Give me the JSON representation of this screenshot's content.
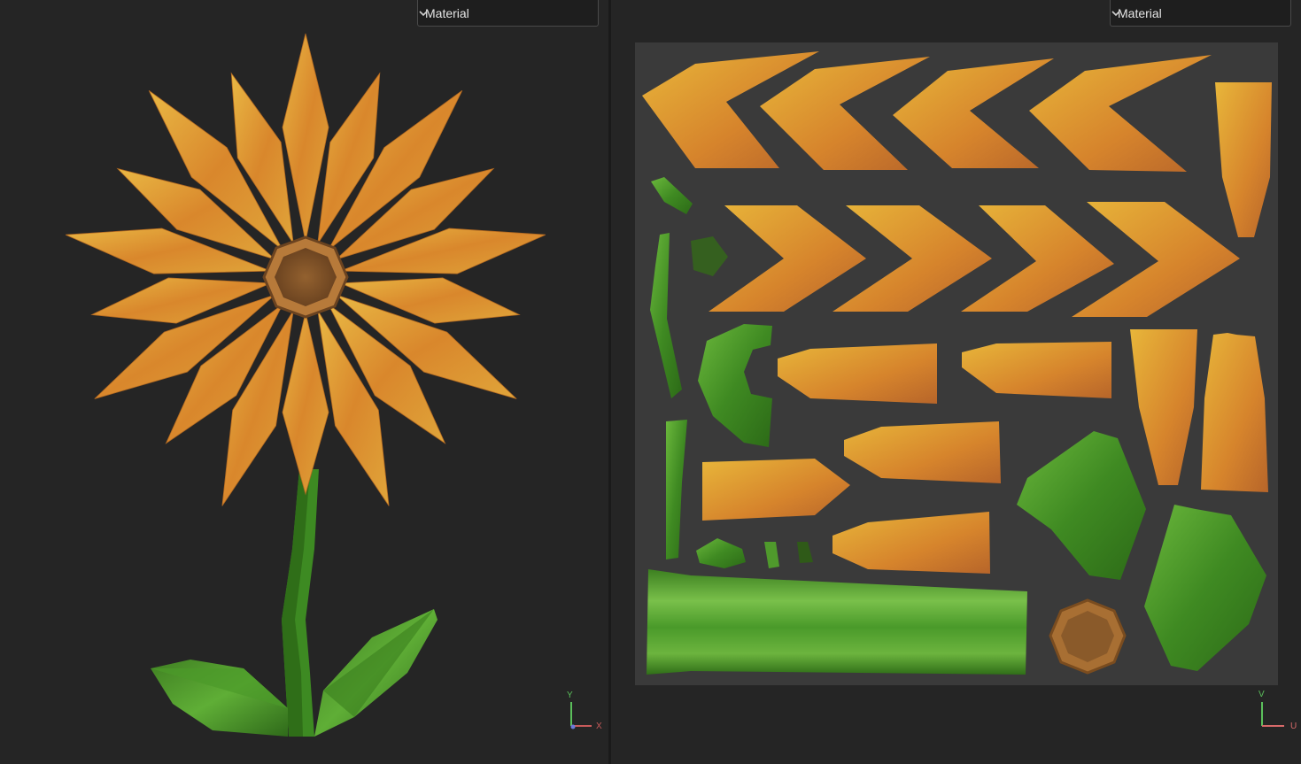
{
  "viewport_3d": {
    "material_dropdown": {
      "selected": "Material"
    },
    "axis_gizmo": {
      "vertical": "Y",
      "horizontal": "X"
    }
  },
  "uv_editor": {
    "material_dropdown": {
      "selected": "Material"
    },
    "axis_gizmo": {
      "vertical": "V",
      "horizontal": "U"
    }
  },
  "colors": {
    "panel_bg": "#252525",
    "uv_canvas_bg": "#3a3a3a",
    "petal_orange": "#d98a2b",
    "petal_yellow": "#e8b63a",
    "stem_green": "#4f9a2c",
    "center_brown": "#8a5a2a"
  }
}
